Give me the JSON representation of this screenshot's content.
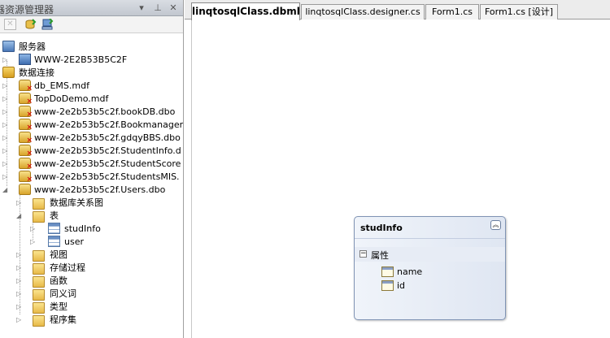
{
  "server_explorer": {
    "title": "器资源管理器",
    "tree": {
      "servers_label": "服务器",
      "server_name": "WWW-2E2B53B5C2F",
      "data_connections_label": "数据连接",
      "connections": [
        "db_EMS.mdf",
        "TopDoDemo.mdf",
        "www-2e2b53b5c2f.bookDB.dbo",
        "www-2e2b53b5c2f.Bookmanager",
        "www-2e2b53b5c2f.gdqyBBS.dbo",
        "www-2e2b53b5c2f.StudentInfo.d",
        "www-2e2b53b5c2f.StudentScore",
        "www-2e2b53b5c2f.StudentsMIS.",
        "www-2e2b53b5c2f.Users.dbo"
      ],
      "users_db_children": [
        "数据库关系图",
        "表",
        "视图",
        "存储过程",
        "函数",
        "同义词",
        "类型",
        "程序集"
      ],
      "tables": [
        "studInfo",
        "user"
      ]
    }
  },
  "tabs": [
    {
      "label": "linqtosqlClass.dbml",
      "active": true
    },
    {
      "label": "linqtosqlClass.designer.cs",
      "active": false
    },
    {
      "label": "Form1.cs",
      "active": false
    },
    {
      "label": "Form1.cs [设计]",
      "active": false
    }
  ],
  "entity": {
    "name": "studInfo",
    "properties_label": "属性",
    "properties": [
      "name",
      "id"
    ]
  }
}
